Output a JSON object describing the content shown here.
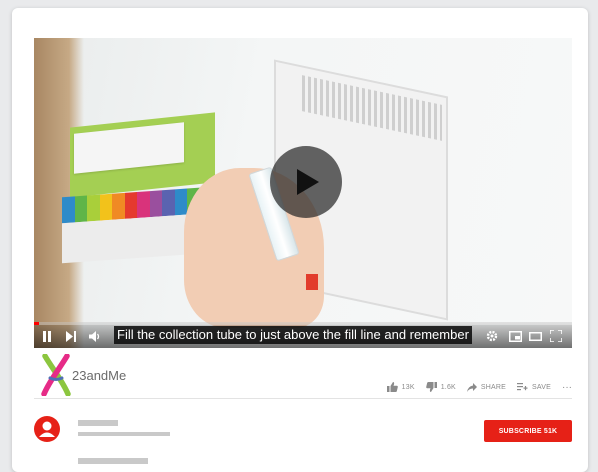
{
  "video": {
    "caption": "Fill the collection tube to just above the fill line and remember",
    "progress_fraction": 0.01
  },
  "channel": {
    "name": "23andMe",
    "logo_colors": [
      "#8cc63f",
      "#e62b87",
      "#4f6fb5"
    ]
  },
  "actions": {
    "like_count": "13K",
    "dislike_count": "1.6K",
    "share_label": "SHARE",
    "save_label": "SAVE",
    "more_label": "···"
  },
  "subscribe": {
    "label": "SUBSCRIBE 51K"
  },
  "colors": {
    "accent": "#e62117",
    "progress": "#ff0000"
  },
  "icons": {
    "play": "play-icon",
    "pause": "pause-icon",
    "next": "next-icon",
    "volume": "volume-icon",
    "settings": "gear-icon",
    "miniplayer": "miniplayer-icon",
    "theater": "theater-icon",
    "fullscreen": "fullscreen-icon",
    "like": "thumbs-up-icon",
    "dislike": "thumbs-down-icon",
    "share": "share-icon",
    "save": "add-to-playlist-icon",
    "avatar": "user-avatar-icon"
  }
}
